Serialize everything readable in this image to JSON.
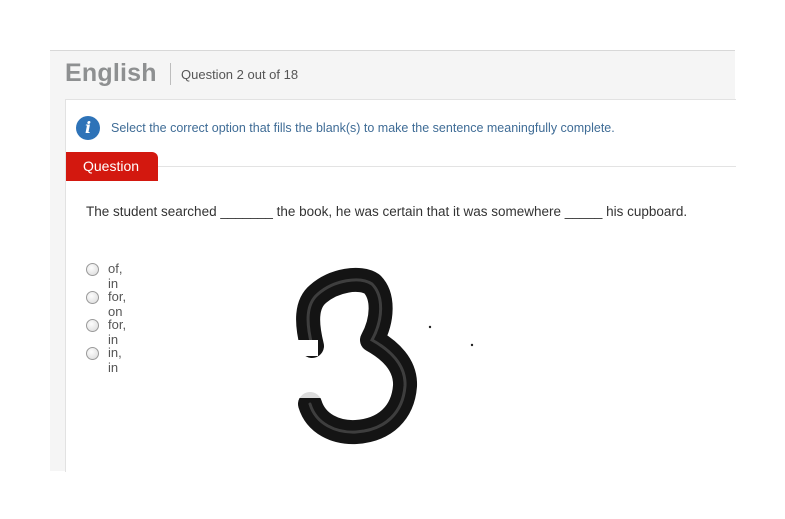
{
  "header": {
    "subject": "English",
    "question_counter": "Question 2 out of 18"
  },
  "instruction": {
    "icon": "info-icon",
    "text": "Select the correct option that fills the blank(s) to make the sentence meaningfully complete."
  },
  "question_tab": {
    "label": "Question"
  },
  "question": {
    "text": "The student searched _______ the book, he was certain that it was somewhere _____ his cupboard.",
    "options": [
      {
        "label": "of, in",
        "selected": false
      },
      {
        "label": "for, on",
        "selected": false
      },
      {
        "label": "for, in",
        "selected": false
      },
      {
        "label": "in, in",
        "selected": false
      }
    ]
  },
  "colors": {
    "subject_gray": "#8e9091",
    "tab_red": "#d3180f",
    "info_blue": "#2e73b8",
    "instruction_text": "#3f6c96"
  }
}
